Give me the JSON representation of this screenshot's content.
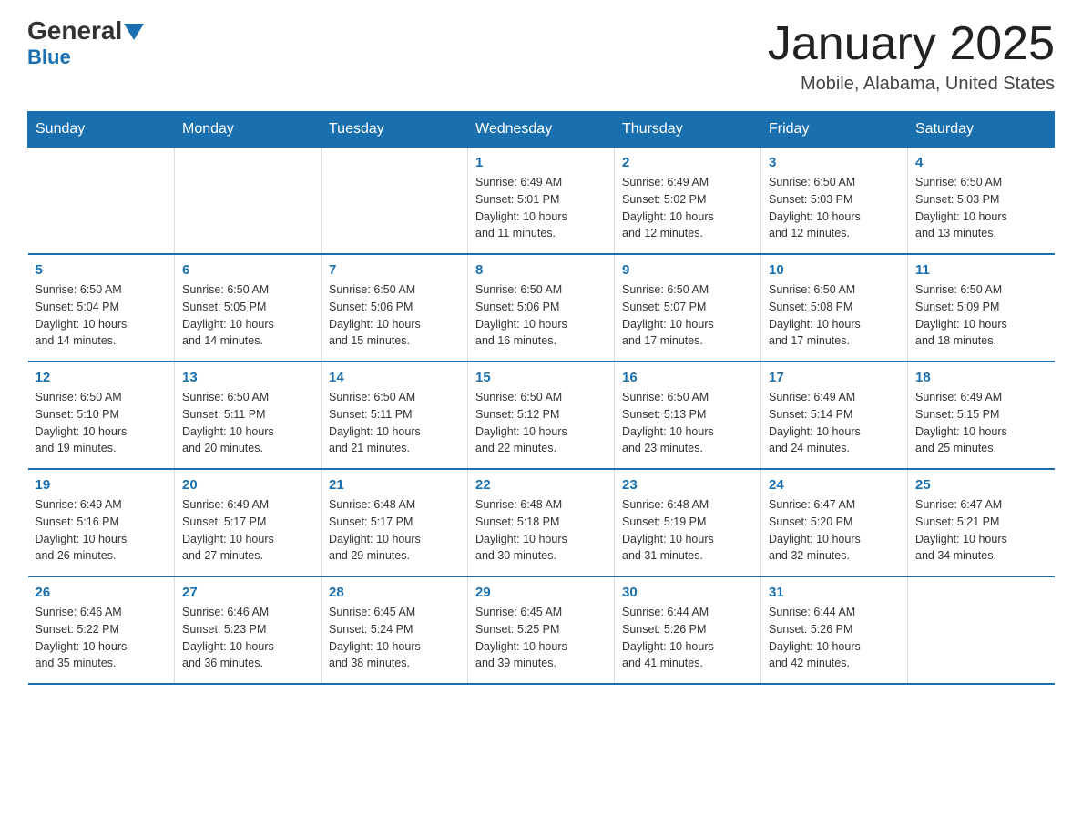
{
  "logo": {
    "general": "General",
    "blue": "Blue",
    "triangle": "▼"
  },
  "title": "January 2025",
  "subtitle": "Mobile, Alabama, United States",
  "days_of_week": [
    "Sunday",
    "Monday",
    "Tuesday",
    "Wednesday",
    "Thursday",
    "Friday",
    "Saturday"
  ],
  "weeks": [
    [
      {
        "day": "",
        "info": ""
      },
      {
        "day": "",
        "info": ""
      },
      {
        "day": "",
        "info": ""
      },
      {
        "day": "1",
        "info": "Sunrise: 6:49 AM\nSunset: 5:01 PM\nDaylight: 10 hours\nand 11 minutes."
      },
      {
        "day": "2",
        "info": "Sunrise: 6:49 AM\nSunset: 5:02 PM\nDaylight: 10 hours\nand 12 minutes."
      },
      {
        "day": "3",
        "info": "Sunrise: 6:50 AM\nSunset: 5:03 PM\nDaylight: 10 hours\nand 12 minutes."
      },
      {
        "day": "4",
        "info": "Sunrise: 6:50 AM\nSunset: 5:03 PM\nDaylight: 10 hours\nand 13 minutes."
      }
    ],
    [
      {
        "day": "5",
        "info": "Sunrise: 6:50 AM\nSunset: 5:04 PM\nDaylight: 10 hours\nand 14 minutes."
      },
      {
        "day": "6",
        "info": "Sunrise: 6:50 AM\nSunset: 5:05 PM\nDaylight: 10 hours\nand 14 minutes."
      },
      {
        "day": "7",
        "info": "Sunrise: 6:50 AM\nSunset: 5:06 PM\nDaylight: 10 hours\nand 15 minutes."
      },
      {
        "day": "8",
        "info": "Sunrise: 6:50 AM\nSunset: 5:06 PM\nDaylight: 10 hours\nand 16 minutes."
      },
      {
        "day": "9",
        "info": "Sunrise: 6:50 AM\nSunset: 5:07 PM\nDaylight: 10 hours\nand 17 minutes."
      },
      {
        "day": "10",
        "info": "Sunrise: 6:50 AM\nSunset: 5:08 PM\nDaylight: 10 hours\nand 17 minutes."
      },
      {
        "day": "11",
        "info": "Sunrise: 6:50 AM\nSunset: 5:09 PM\nDaylight: 10 hours\nand 18 minutes."
      }
    ],
    [
      {
        "day": "12",
        "info": "Sunrise: 6:50 AM\nSunset: 5:10 PM\nDaylight: 10 hours\nand 19 minutes."
      },
      {
        "day": "13",
        "info": "Sunrise: 6:50 AM\nSunset: 5:11 PM\nDaylight: 10 hours\nand 20 minutes."
      },
      {
        "day": "14",
        "info": "Sunrise: 6:50 AM\nSunset: 5:11 PM\nDaylight: 10 hours\nand 21 minutes."
      },
      {
        "day": "15",
        "info": "Sunrise: 6:50 AM\nSunset: 5:12 PM\nDaylight: 10 hours\nand 22 minutes."
      },
      {
        "day": "16",
        "info": "Sunrise: 6:50 AM\nSunset: 5:13 PM\nDaylight: 10 hours\nand 23 minutes."
      },
      {
        "day": "17",
        "info": "Sunrise: 6:49 AM\nSunset: 5:14 PM\nDaylight: 10 hours\nand 24 minutes."
      },
      {
        "day": "18",
        "info": "Sunrise: 6:49 AM\nSunset: 5:15 PM\nDaylight: 10 hours\nand 25 minutes."
      }
    ],
    [
      {
        "day": "19",
        "info": "Sunrise: 6:49 AM\nSunset: 5:16 PM\nDaylight: 10 hours\nand 26 minutes."
      },
      {
        "day": "20",
        "info": "Sunrise: 6:49 AM\nSunset: 5:17 PM\nDaylight: 10 hours\nand 27 minutes."
      },
      {
        "day": "21",
        "info": "Sunrise: 6:48 AM\nSunset: 5:17 PM\nDaylight: 10 hours\nand 29 minutes."
      },
      {
        "day": "22",
        "info": "Sunrise: 6:48 AM\nSunset: 5:18 PM\nDaylight: 10 hours\nand 30 minutes."
      },
      {
        "day": "23",
        "info": "Sunrise: 6:48 AM\nSunset: 5:19 PM\nDaylight: 10 hours\nand 31 minutes."
      },
      {
        "day": "24",
        "info": "Sunrise: 6:47 AM\nSunset: 5:20 PM\nDaylight: 10 hours\nand 32 minutes."
      },
      {
        "day": "25",
        "info": "Sunrise: 6:47 AM\nSunset: 5:21 PM\nDaylight: 10 hours\nand 34 minutes."
      }
    ],
    [
      {
        "day": "26",
        "info": "Sunrise: 6:46 AM\nSunset: 5:22 PM\nDaylight: 10 hours\nand 35 minutes."
      },
      {
        "day": "27",
        "info": "Sunrise: 6:46 AM\nSunset: 5:23 PM\nDaylight: 10 hours\nand 36 minutes."
      },
      {
        "day": "28",
        "info": "Sunrise: 6:45 AM\nSunset: 5:24 PM\nDaylight: 10 hours\nand 38 minutes."
      },
      {
        "day": "29",
        "info": "Sunrise: 6:45 AM\nSunset: 5:25 PM\nDaylight: 10 hours\nand 39 minutes."
      },
      {
        "day": "30",
        "info": "Sunrise: 6:44 AM\nSunset: 5:26 PM\nDaylight: 10 hours\nand 41 minutes."
      },
      {
        "day": "31",
        "info": "Sunrise: 6:44 AM\nSunset: 5:26 PM\nDaylight: 10 hours\nand 42 minutes."
      },
      {
        "day": "",
        "info": ""
      }
    ]
  ]
}
